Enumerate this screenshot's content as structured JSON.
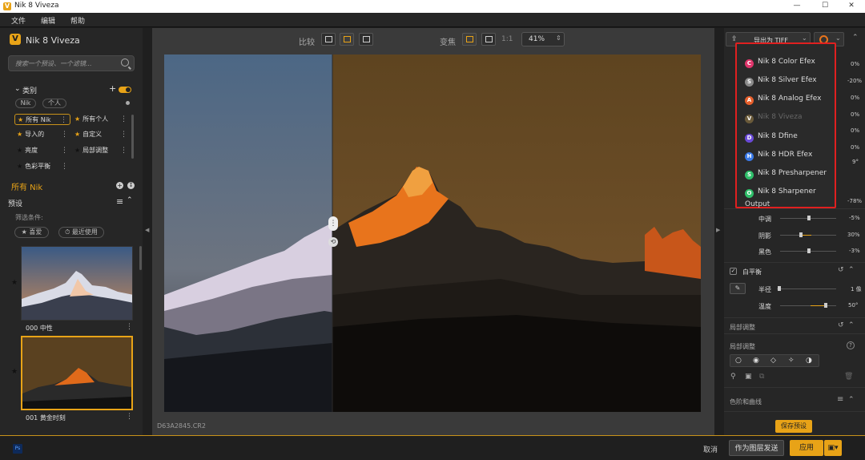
{
  "window": {
    "title": "Nik 8 Viveza",
    "logo_letter": "V",
    "controls": {
      "minimize": "—",
      "maximize": "☐",
      "close": "✕"
    }
  },
  "menu": [
    "文件",
    "编辑",
    "帮助"
  ],
  "left": {
    "app_name": "Nik 8 Viveza",
    "search_placeholder": "搜索一个预设、一个滤镜...",
    "category_header": "类别",
    "chips": [
      "Nik",
      "个人"
    ],
    "categories": [
      {
        "label": "所有 Nik",
        "selected": true
      },
      {
        "label": "所有个人"
      },
      {
        "label": "导入的"
      },
      {
        "label": "自定义"
      },
      {
        "label": "亮度"
      },
      {
        "label": "局部调整"
      },
      {
        "label": "色彩平衡"
      }
    ],
    "all_nik": "所有 Nik",
    "presets_header": "预设",
    "filter_label": "筛选条件:",
    "filter_buttons": [
      "★ 喜爱",
      "⏱ 最近使用"
    ],
    "presets": [
      {
        "label": "000 中性"
      },
      {
        "label": "001 黄金时刻"
      }
    ]
  },
  "toolbar": {
    "compare_label": "比较",
    "zoom_label": "变焦",
    "one_to_one": "1:1",
    "zoom_value": "41%"
  },
  "filename": "D63A2845.CR2",
  "right": {
    "export_label": "导出为 TIFF",
    "values_top": [
      "0%",
      "-20%",
      "0%",
      "0%",
      "0%",
      "0%",
      "9°"
    ],
    "value_mid": "-78%",
    "tone_rows": [
      {
        "label": "中调",
        "value": "-5%"
      },
      {
        "label": "阴影",
        "value": "30%"
      },
      {
        "label": "黑色",
        "value": "-3%"
      }
    ],
    "white_balance": "白平衡",
    "wb_rows": [
      {
        "label": "半径",
        "value": "1 像"
      },
      {
        "label": "温度",
        "value": "50°"
      }
    ],
    "local_adjust": "局部调整",
    "local_sub": "局部调整",
    "levels_curves": "色阶和曲线",
    "save_preset": "保存预设"
  },
  "dropdown": {
    "items": [
      {
        "label": "Nik 8 Color Efex",
        "letter": "C",
        "color": "#e0356b"
      },
      {
        "label": "Nik 8 Silver Efex",
        "letter": "S",
        "color": "#8a8a8a"
      },
      {
        "label": "Nik 8 Analog Efex",
        "letter": "A",
        "color": "#e8602c"
      },
      {
        "label": "Nik 8 Viveza",
        "letter": "V",
        "color": "#6a5a3a",
        "disabled": true
      },
      {
        "label": "Nik 8 Dfine",
        "letter": "D",
        "color": "#6a4ad8"
      },
      {
        "label": "Nik 8 HDR Efex",
        "letter": "H",
        "color": "#3a7ae8"
      },
      {
        "label": "Nik 8 Presharpener",
        "letter": "S",
        "color": "#2fbf6a"
      },
      {
        "label": "Nik 8 Sharpener Output",
        "letter": "O",
        "color": "#2fbf6a"
      }
    ]
  },
  "bottom": {
    "ps_badge": "Ps",
    "cancel": "取消",
    "send_as_layer": "作为图层发送",
    "apply": "应用"
  },
  "colors": {
    "accent": "#e8a317",
    "highlight_border": "#e02020",
    "panel": "#262626"
  }
}
